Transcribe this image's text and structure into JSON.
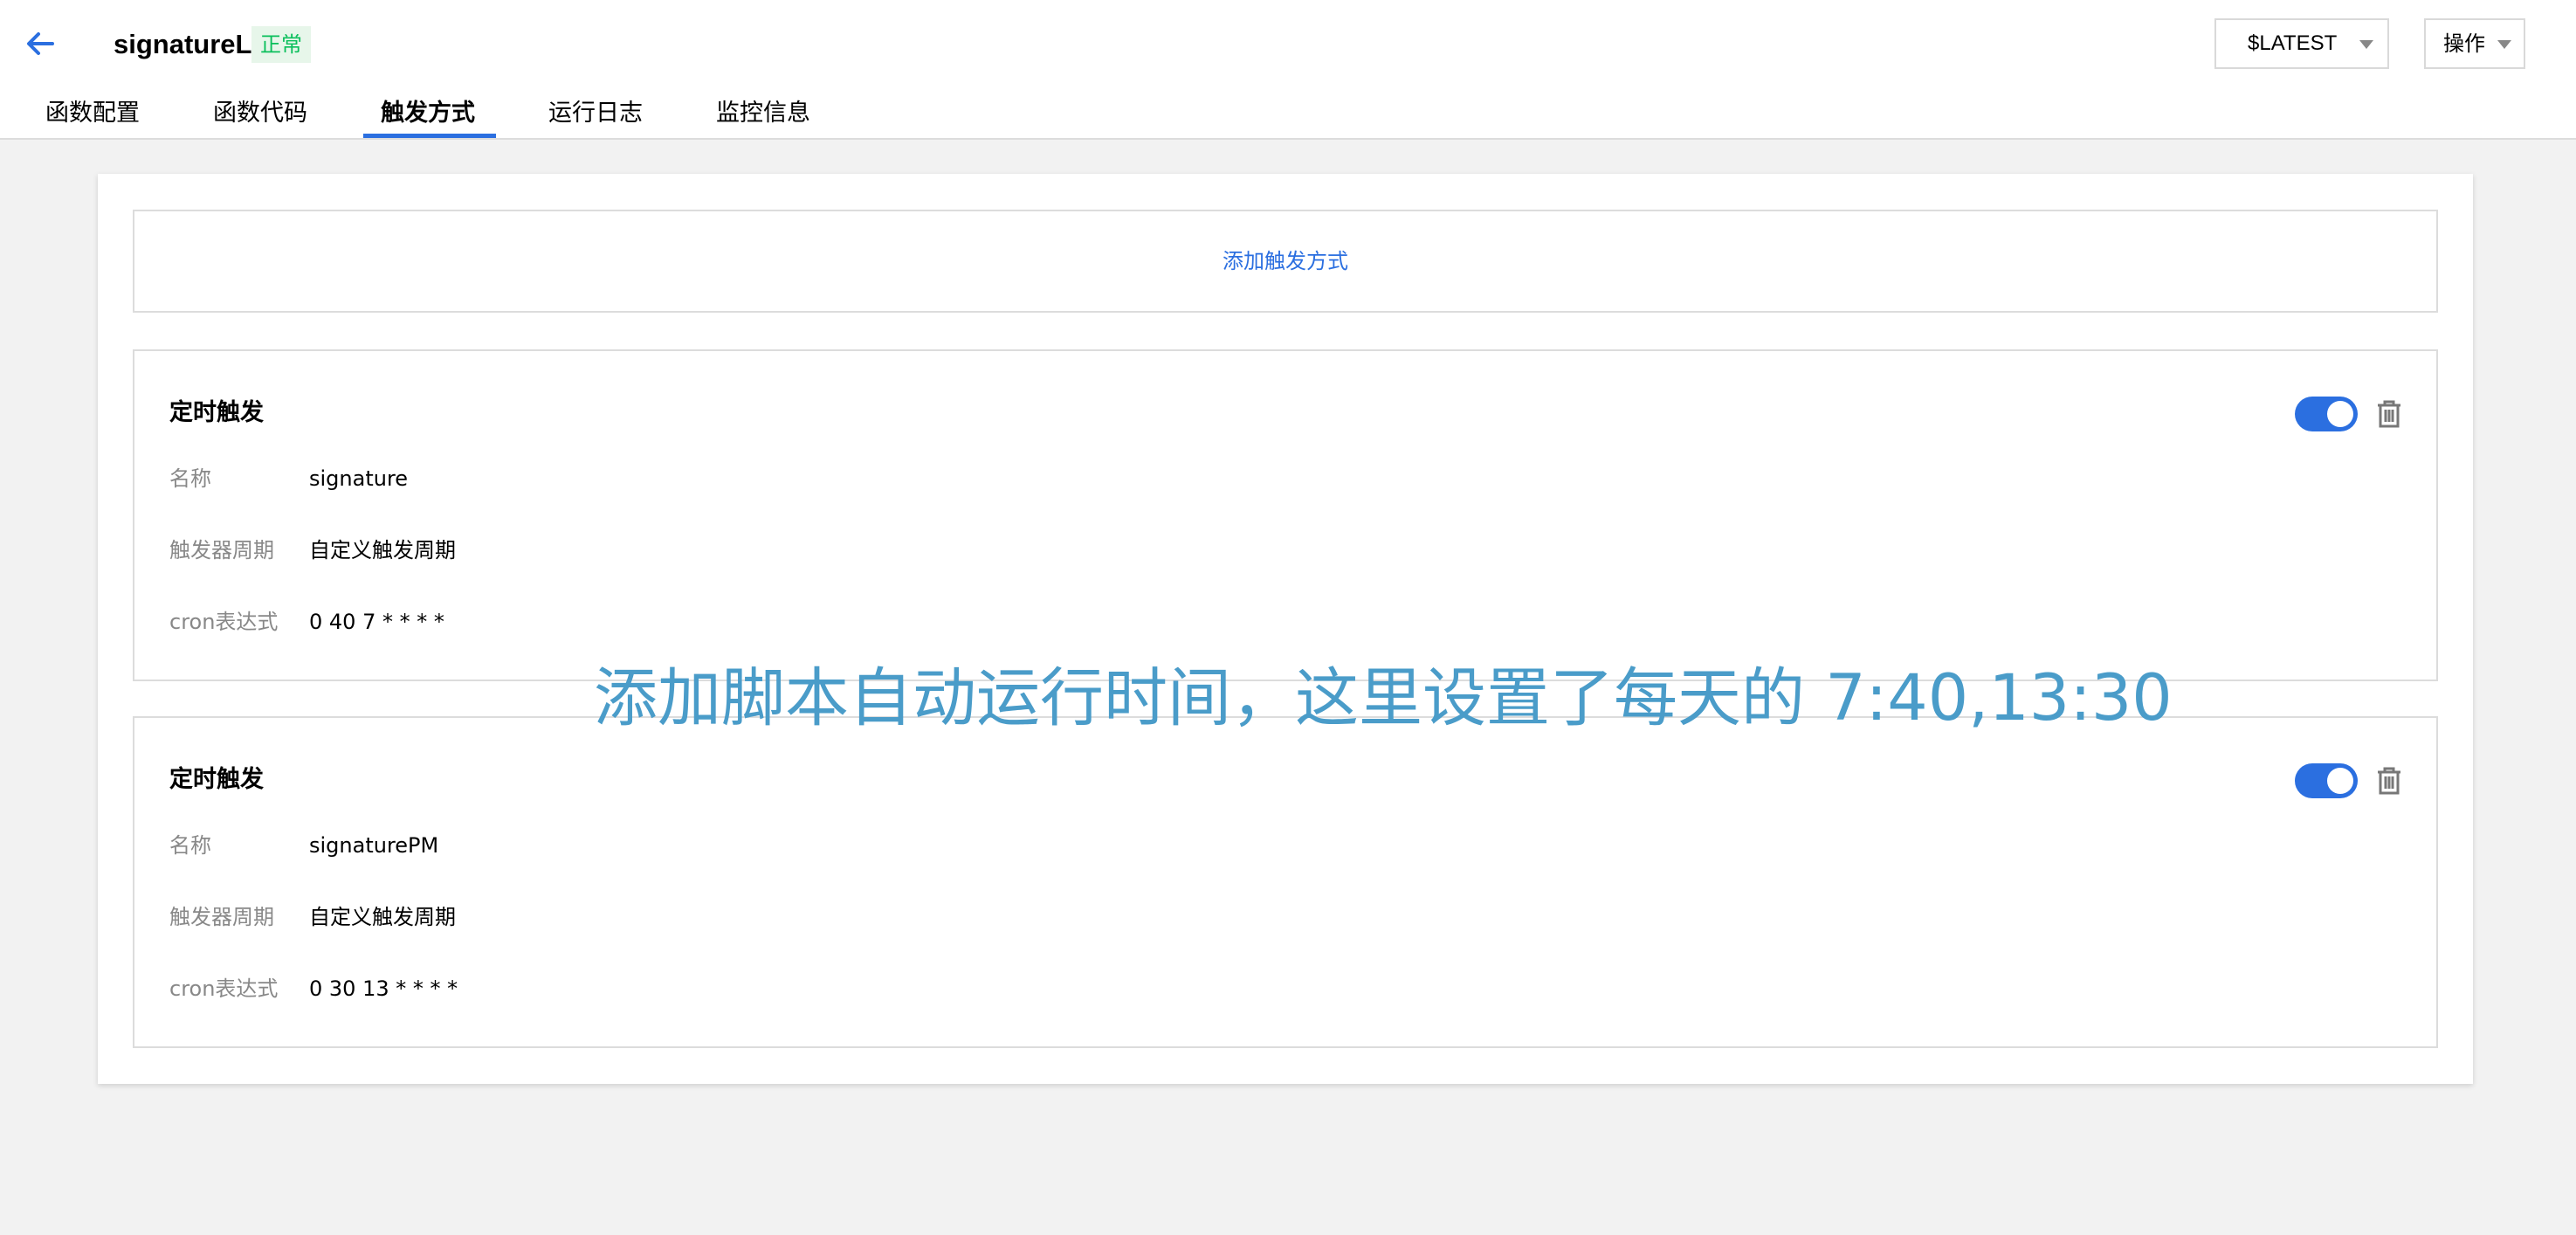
{
  "header": {
    "function_name": "signatureLGY",
    "status": "正常",
    "version": "$LATEST",
    "operations_label": "操作",
    "tabs": [
      {
        "label": "函数配置",
        "active": false
      },
      {
        "label": "函数代码",
        "active": false
      },
      {
        "label": "触发方式",
        "active": true
      },
      {
        "label": "运行日志",
        "active": false
      },
      {
        "label": "监控信息",
        "active": false
      }
    ]
  },
  "main": {
    "add_trigger_label": "添加触发方式",
    "triggers": [
      {
        "title": "定时触发",
        "enabled": true,
        "fields": [
          {
            "label": "名称",
            "value": "signature"
          },
          {
            "label": "触发器周期",
            "value": "自定义触发周期"
          },
          {
            "label": "cron表达式",
            "value": "0 40 7 * * * *"
          }
        ]
      },
      {
        "title": "定时触发",
        "enabled": true,
        "fields": [
          {
            "label": "名称",
            "value": "signaturePM"
          },
          {
            "label": "触发器周期",
            "value": "自定义触发周期"
          },
          {
            "label": "cron表达式",
            "value": "0 30 13 * * * *"
          }
        ]
      }
    ]
  },
  "annotation": "添加脚本自动运行时间，这里设置了每天的 7:40,13:30",
  "colors": {
    "accent": "#2b6fe0",
    "status_green": "#0abf5b",
    "annotation": "#4a9cc9"
  },
  "icons": {
    "back": "arrow-left-icon",
    "dropdown": "caret-down-icon",
    "delete": "trash-icon"
  }
}
